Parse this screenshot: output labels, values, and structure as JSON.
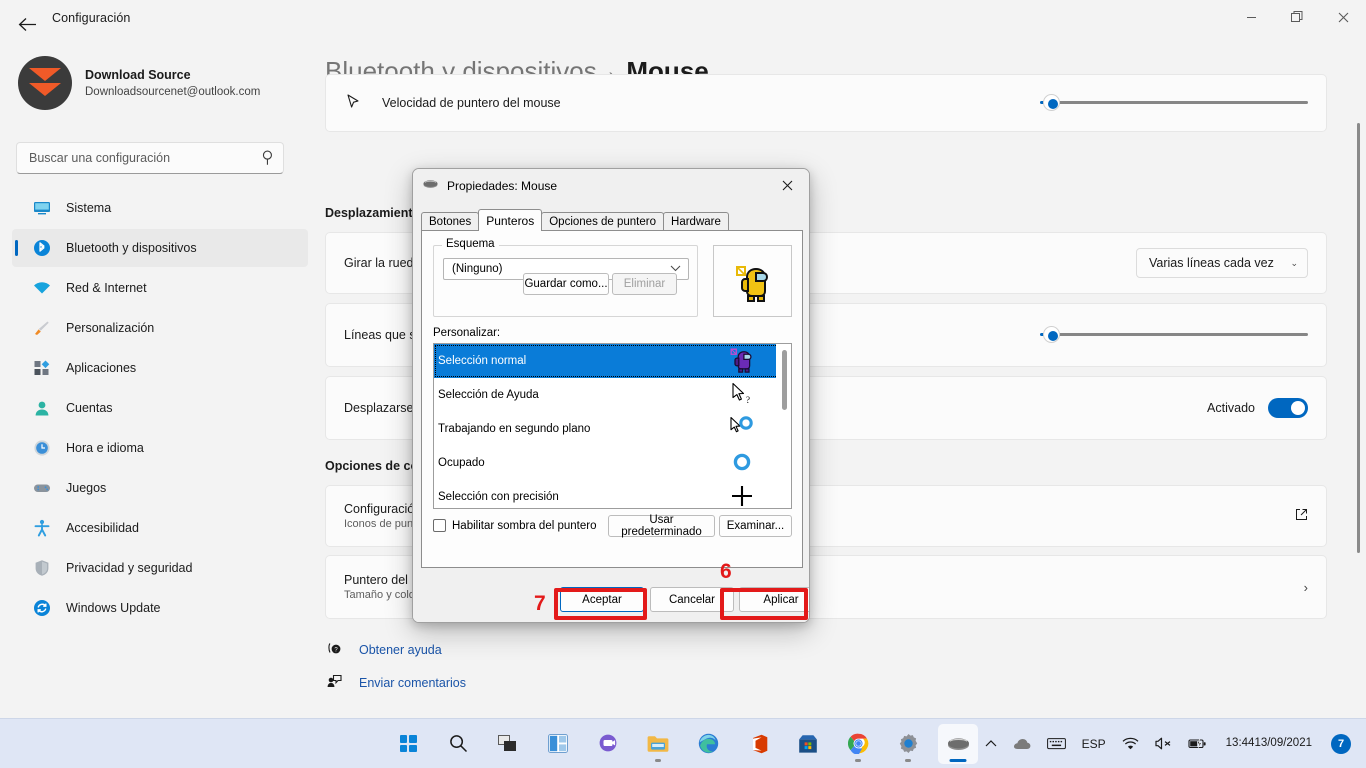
{
  "window": {
    "title": "Configuración",
    "back_icon": "back-arrow-icon",
    "minimize": "–",
    "maximize": "❐",
    "close": "✕"
  },
  "account": {
    "name": "Download Source",
    "email": "Downloadsourcenet@outlook.com"
  },
  "search": {
    "placeholder": "Buscar una configuración",
    "value": "",
    "icon": "search-icon"
  },
  "sidebar": {
    "items": [
      {
        "label": "Sistema",
        "icon": "monitor-icon",
        "glyph": "🖥",
        "active": false
      },
      {
        "label": "Bluetooth y dispositivos",
        "icon": "bluetooth-icon",
        "glyph": "🔵",
        "active": true
      },
      {
        "label": "Red & Internet",
        "icon": "wifi-icon",
        "glyph": "🔷",
        "active": false
      },
      {
        "label": "Personalización",
        "icon": "paintbrush-icon",
        "glyph": "🖌",
        "active": false
      },
      {
        "label": "Aplicaciones",
        "icon": "apps-icon",
        "glyph": "▣",
        "active": false
      },
      {
        "label": "Cuentas",
        "icon": "person-icon",
        "glyph": "👤",
        "active": false
      },
      {
        "label": "Hora e idioma",
        "icon": "clock-icon",
        "glyph": "🕐",
        "active": false
      },
      {
        "label": "Juegos",
        "icon": "gamepad-icon",
        "glyph": "🎮",
        "active": false
      },
      {
        "label": "Accesibilidad",
        "icon": "accessibility-icon",
        "glyph": "🧍",
        "active": false
      },
      {
        "label": "Privacidad y seguridad",
        "icon": "shield-icon",
        "glyph": "🛡",
        "active": false
      },
      {
        "label": "Windows Update",
        "icon": "update-icon",
        "glyph": "🔄",
        "active": false
      }
    ]
  },
  "breadcrumb": {
    "parent": "Bluetooth y dispositivos",
    "separator": "›",
    "current": "Mouse"
  },
  "main": {
    "partial_card": {
      "title": "Velocidad de puntero del mouse",
      "icon": "cursor-icon"
    },
    "section_scroll": "Desplazamiento",
    "rows": [
      {
        "title": "Girar la rueda del mouse para desplazarse",
        "control": "combo",
        "value": "Varias líneas cada vez",
        "chevron": "⌄"
      },
      {
        "title": "Líneas que se desplazarán cada vez",
        "control": "slider",
        "value": "1"
      },
      {
        "title": "Desplazarse con las ventanas inactivas al mantener el puntero sobre ellas",
        "control": "toggle",
        "value": "Activado"
      }
    ],
    "section_related": "Opciones de configuración relacionadas",
    "related": [
      {
        "title": "Configuración adicional del mouse",
        "subtitle": "Iconos de puntero, velocidad del puntero",
        "action_icon": "external-link-icon",
        "action_glyph": "⇱"
      },
      {
        "title": "Puntero del mouse y entrada táctil",
        "subtitle": "Tamaño y color del puntero del mouse",
        "action_icon": "chevron-right-icon",
        "action_glyph": "›"
      }
    ],
    "help_links": [
      {
        "label": "Obtener ayuda",
        "icon": "help-question-icon",
        "glyph": "?"
      },
      {
        "label": "Enviar comentarios",
        "icon": "feedback-icon",
        "glyph": "🗨"
      }
    ]
  },
  "dialog": {
    "title": "Propiedades: Mouse",
    "title_icon": "mouse-icon",
    "close_icon": "close-icon",
    "tabs": [
      {
        "label": "Botones",
        "active": false
      },
      {
        "label": "Punteros",
        "active": true
      },
      {
        "label": "Opciones de puntero",
        "active": false
      },
      {
        "label": "Hardware",
        "active": false
      }
    ],
    "scheme": {
      "legend": "Esquema",
      "value": "(Ninguno)",
      "chevron": "⌄",
      "save_as": "Guardar como...",
      "delete": "Eliminar",
      "preview_icon": "amongus-yellow-cursor-icon"
    },
    "customize_label": "Personalizar:",
    "cursor_list": [
      {
        "label": "Selección normal",
        "cursor_icon": "amongus-purple-cursor-icon",
        "selected": true
      },
      {
        "label": "Selección de Ayuda",
        "cursor_icon": "arrow-question-cursor-icon",
        "selected": false
      },
      {
        "label": "Trabajando en segundo plano",
        "cursor_icon": "arrow-busy-cursor-icon",
        "selected": false
      },
      {
        "label": "Ocupado",
        "cursor_icon": "busy-ring-cursor-icon",
        "selected": false
      },
      {
        "label": "Selección con precisión",
        "cursor_icon": "crosshair-cursor-icon",
        "selected": false
      }
    ],
    "shadow_checkbox": {
      "label": "Habilitar sombra del puntero",
      "checked": false
    },
    "use_default": "Usar predeterminado",
    "browse": "Examinar...",
    "buttons": {
      "ok": "Aceptar",
      "cancel": "Cancelar",
      "apply": "Aplicar"
    }
  },
  "annotations": [
    {
      "number": "6",
      "target": "apply-button"
    },
    {
      "number": "7",
      "target": "ok-button"
    }
  ],
  "taskbar": {
    "items": [
      {
        "name": "start-button",
        "glyph": "win",
        "running": false,
        "active": false
      },
      {
        "name": "search-button",
        "glyph": "🔍",
        "running": false,
        "active": false
      },
      {
        "name": "task-view-button",
        "glyph": "▤",
        "running": false,
        "active": false
      },
      {
        "name": "widgets-button",
        "glyph": "▥",
        "running": false,
        "active": false
      },
      {
        "name": "chat-button",
        "glyph": "💬",
        "running": false,
        "active": false
      },
      {
        "name": "file-explorer-button",
        "glyph": "📁",
        "running": true,
        "active": false
      },
      {
        "name": "edge-button",
        "glyph": "🌀",
        "running": false,
        "active": false
      },
      {
        "name": "office-button",
        "glyph": "◐",
        "running": false,
        "active": false
      },
      {
        "name": "microsoft-store-button",
        "glyph": "🛍",
        "running": false,
        "active": false
      },
      {
        "name": "chrome-button",
        "glyph": "◉",
        "running": true,
        "active": false
      },
      {
        "name": "settings-button",
        "glyph": "⚙",
        "running": true,
        "active": false
      },
      {
        "name": "mouse-properties-button",
        "glyph": "🖱",
        "running": true,
        "active": true
      }
    ],
    "tray": {
      "overflow_icon": "chevron-up-icon",
      "overflow_glyph": "⌃",
      "cloud_icon": "onedrive-icon",
      "cloud_glyph": "☁",
      "keyboard_icon": "keyboard-icon",
      "keyboard_glyph": "⌨",
      "language": "ESP",
      "wifi_icon": "wifi-icon",
      "wifi_glyph": "📶",
      "volume_icon": "volume-muted-icon",
      "volume_glyph": "🔇",
      "battery_icon": "battery-charging-icon",
      "battery_glyph": "🔋",
      "time": "13:44",
      "date": "13/09/2021",
      "notification_count": "7"
    }
  }
}
